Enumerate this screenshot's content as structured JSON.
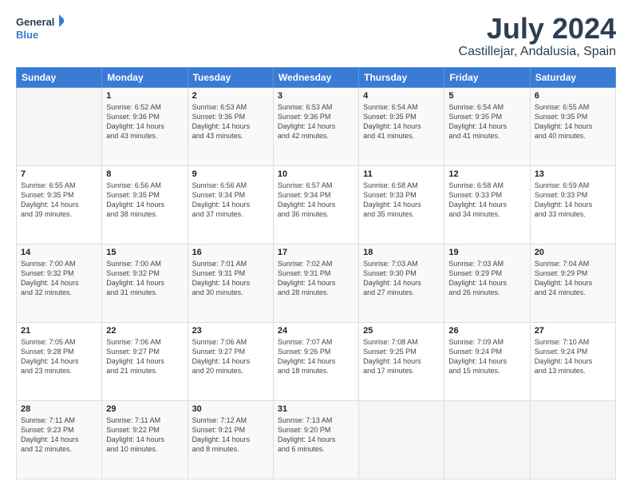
{
  "logo": {
    "line1": "General",
    "line2": "Blue"
  },
  "header": {
    "month": "July 2024",
    "location": "Castillejar, Andalusia, Spain"
  },
  "weekdays": [
    "Sunday",
    "Monday",
    "Tuesday",
    "Wednesday",
    "Thursday",
    "Friday",
    "Saturday"
  ],
  "weeks": [
    [
      {
        "num": "",
        "content": ""
      },
      {
        "num": "1",
        "content": "Sunrise: 6:52 AM\nSunset: 9:36 PM\nDaylight: 14 hours\nand 43 minutes."
      },
      {
        "num": "2",
        "content": "Sunrise: 6:53 AM\nSunset: 9:36 PM\nDaylight: 14 hours\nand 43 minutes."
      },
      {
        "num": "3",
        "content": "Sunrise: 6:53 AM\nSunset: 9:36 PM\nDaylight: 14 hours\nand 42 minutes."
      },
      {
        "num": "4",
        "content": "Sunrise: 6:54 AM\nSunset: 9:35 PM\nDaylight: 14 hours\nand 41 minutes."
      },
      {
        "num": "5",
        "content": "Sunrise: 6:54 AM\nSunset: 9:35 PM\nDaylight: 14 hours\nand 41 minutes."
      },
      {
        "num": "6",
        "content": "Sunrise: 6:55 AM\nSunset: 9:35 PM\nDaylight: 14 hours\nand 40 minutes."
      }
    ],
    [
      {
        "num": "7",
        "content": "Sunrise: 6:55 AM\nSunset: 9:35 PM\nDaylight: 14 hours\nand 39 minutes."
      },
      {
        "num": "8",
        "content": "Sunrise: 6:56 AM\nSunset: 9:35 PM\nDaylight: 14 hours\nand 38 minutes."
      },
      {
        "num": "9",
        "content": "Sunrise: 6:56 AM\nSunset: 9:34 PM\nDaylight: 14 hours\nand 37 minutes."
      },
      {
        "num": "10",
        "content": "Sunrise: 6:57 AM\nSunset: 9:34 PM\nDaylight: 14 hours\nand 36 minutes."
      },
      {
        "num": "11",
        "content": "Sunrise: 6:58 AM\nSunset: 9:33 PM\nDaylight: 14 hours\nand 35 minutes."
      },
      {
        "num": "12",
        "content": "Sunrise: 6:58 AM\nSunset: 9:33 PM\nDaylight: 14 hours\nand 34 minutes."
      },
      {
        "num": "13",
        "content": "Sunrise: 6:59 AM\nSunset: 9:33 PM\nDaylight: 14 hours\nand 33 minutes."
      }
    ],
    [
      {
        "num": "14",
        "content": "Sunrise: 7:00 AM\nSunset: 9:32 PM\nDaylight: 14 hours\nand 32 minutes."
      },
      {
        "num": "15",
        "content": "Sunrise: 7:00 AM\nSunset: 9:32 PM\nDaylight: 14 hours\nand 31 minutes."
      },
      {
        "num": "16",
        "content": "Sunrise: 7:01 AM\nSunset: 9:31 PM\nDaylight: 14 hours\nand 30 minutes."
      },
      {
        "num": "17",
        "content": "Sunrise: 7:02 AM\nSunset: 9:31 PM\nDaylight: 14 hours\nand 28 minutes."
      },
      {
        "num": "18",
        "content": "Sunrise: 7:03 AM\nSunset: 9:30 PM\nDaylight: 14 hours\nand 27 minutes."
      },
      {
        "num": "19",
        "content": "Sunrise: 7:03 AM\nSunset: 9:29 PM\nDaylight: 14 hours\nand 26 minutes."
      },
      {
        "num": "20",
        "content": "Sunrise: 7:04 AM\nSunset: 9:29 PM\nDaylight: 14 hours\nand 24 minutes."
      }
    ],
    [
      {
        "num": "21",
        "content": "Sunrise: 7:05 AM\nSunset: 9:28 PM\nDaylight: 14 hours\nand 23 minutes."
      },
      {
        "num": "22",
        "content": "Sunrise: 7:06 AM\nSunset: 9:27 PM\nDaylight: 14 hours\nand 21 minutes."
      },
      {
        "num": "23",
        "content": "Sunrise: 7:06 AM\nSunset: 9:27 PM\nDaylight: 14 hours\nand 20 minutes."
      },
      {
        "num": "24",
        "content": "Sunrise: 7:07 AM\nSunset: 9:26 PM\nDaylight: 14 hours\nand 18 minutes."
      },
      {
        "num": "25",
        "content": "Sunrise: 7:08 AM\nSunset: 9:25 PM\nDaylight: 14 hours\nand 17 minutes."
      },
      {
        "num": "26",
        "content": "Sunrise: 7:09 AM\nSunset: 9:24 PM\nDaylight: 14 hours\nand 15 minutes."
      },
      {
        "num": "27",
        "content": "Sunrise: 7:10 AM\nSunset: 9:24 PM\nDaylight: 14 hours\nand 13 minutes."
      }
    ],
    [
      {
        "num": "28",
        "content": "Sunrise: 7:11 AM\nSunset: 9:23 PM\nDaylight: 14 hours\nand 12 minutes."
      },
      {
        "num": "29",
        "content": "Sunrise: 7:11 AM\nSunset: 9:22 PM\nDaylight: 14 hours\nand 10 minutes."
      },
      {
        "num": "30",
        "content": "Sunrise: 7:12 AM\nSunset: 9:21 PM\nDaylight: 14 hours\nand 8 minutes."
      },
      {
        "num": "31",
        "content": "Sunrise: 7:13 AM\nSunset: 9:20 PM\nDaylight: 14 hours\nand 6 minutes."
      },
      {
        "num": "",
        "content": ""
      },
      {
        "num": "",
        "content": ""
      },
      {
        "num": "",
        "content": ""
      }
    ]
  ]
}
